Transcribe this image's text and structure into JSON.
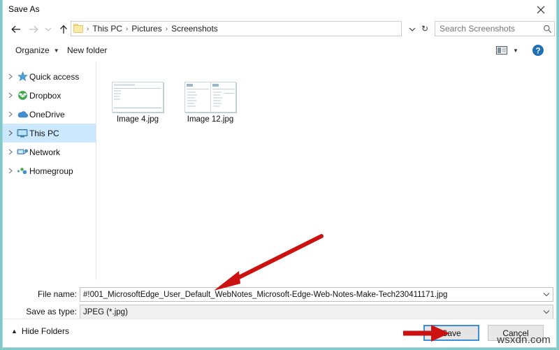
{
  "window": {
    "title": "Save As",
    "close_label": "✕"
  },
  "nav": {
    "back_icon": "arrow-left-icon",
    "forward_icon": "arrow-right-icon",
    "history_icon": "chevron-down-icon",
    "up_icon": "arrow-up-icon",
    "breadcrumbs": [
      "This PC",
      "Pictures",
      "Screenshots"
    ],
    "separator": "›",
    "address_chevron": "chevron-down-icon",
    "refresh_icon": "refresh-icon",
    "refresh_glyph": "↻"
  },
  "search": {
    "placeholder": "Search Screenshots",
    "value": "",
    "icon": "search-icon"
  },
  "toolbar": {
    "organize_label": "Organize",
    "organize_caret": "▼",
    "new_folder_label": "New folder",
    "view_icon": "view-options-icon",
    "view_caret": "▼",
    "help_icon": "help-icon"
  },
  "sidebar": {
    "items": [
      {
        "label": "Quick access",
        "icon": "star-icon",
        "selected": false
      },
      {
        "label": "Dropbox",
        "icon": "dropbox-icon",
        "selected": false
      },
      {
        "label": "OneDrive",
        "icon": "cloud-icon",
        "selected": false
      },
      {
        "label": "This PC",
        "icon": "monitor-icon",
        "selected": true
      },
      {
        "label": "Network",
        "icon": "network-icon",
        "selected": false
      },
      {
        "label": "Homegroup",
        "icon": "homegroup-icon",
        "selected": false
      }
    ],
    "expand_arrow": "chevron-right-icon"
  },
  "files": {
    "items": [
      {
        "name": "Image 4.jpg",
        "thumb": "document-screenshot"
      },
      {
        "name": "Image 12.jpg",
        "thumb": "two-pane-screenshot"
      }
    ]
  },
  "form": {
    "filename_label": "File name:",
    "filename_value": "#!001_MicrosoftEdge_User_Default_WebNotes_Microsoft-Edge-Web-Notes-Make-Tech230411171.jpg",
    "filetype_label": "Save as type:",
    "filetype_value": "JPEG (*.jpg)",
    "dropdown_icon": "chevron-down-icon"
  },
  "footer": {
    "hide_folders_label": "Hide Folders",
    "hide_folders_chevron": "▲",
    "save_label": "Save",
    "cancel_label": "Cancel"
  },
  "annotations": {
    "arrow_to_filename": "red-arrow-pointing-to-filename-field",
    "arrow_to_save": "red-arrow-pointing-to-save-button",
    "watermark": "wsxdn.com"
  },
  "colors": {
    "accent": "#3b8fd4",
    "selection": "#cce8ff",
    "annotation_red": "#cc1111",
    "frame_teal": "#7fc9c9"
  }
}
